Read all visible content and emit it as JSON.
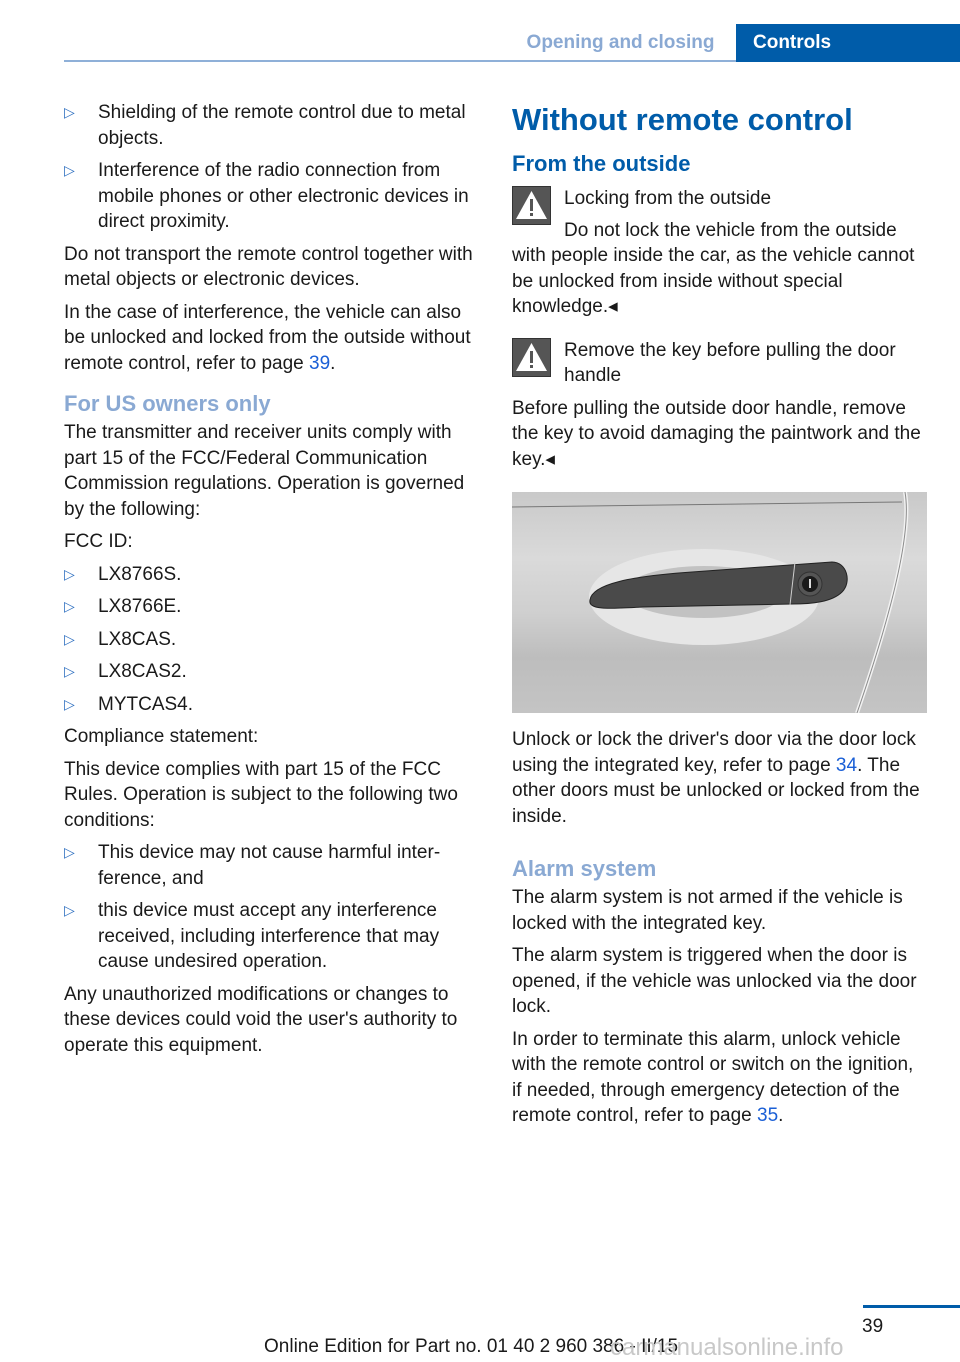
{
  "header": {
    "section": "Opening and closing",
    "chapter_tab": "Controls"
  },
  "left_column": {
    "bullets_top": [
      "Shielding of the remote control due to metal objects.",
      "Interference of the radio connection from mobile phones or other electronic devices in direct proximity."
    ],
    "para1": "Do not transport the remote control together with metal objects or electronic devices.",
    "para2_prefix": "In the case of interference, the vehicle can also be unlocked and locked from the outside with­out remote control, refer to page ",
    "para2_link": "39",
    "para2_suffix": ".",
    "us_heading": "For US owners only",
    "us_para": "The transmitter and receiver units comply with part 15 of the FCC/Federal Communication Commission regulations. Operation is gov­erned by the following:",
    "fcc_label": "FCC ID:",
    "fcc_ids": [
      "LX8766S.",
      "LX8766E.",
      "LX8CAS.",
      "LX8CAS2.",
      "MYTCAS4."
    ],
    "compliance_label": "Compliance statement:",
    "compliance_para": "This device complies with part 15 of the FCC Rules. Operation is subject to the following two conditions:",
    "conditions": [
      "This device may not cause harmful inter­ference, and",
      "this device must accept any interference received, including interference that may cause undesired operation."
    ],
    "final_para": "Any unauthorized modifications or changes to these devices could void the user's authority to operate this equipment."
  },
  "right_column": {
    "title": "Without remote control",
    "subtitle": "From the outside",
    "warning1": {
      "icon": "warning-triangle-icon",
      "title": "Locking from the outside",
      "body_first": "Do not lock the vehicle from the outside",
      "body_rest": "with people inside the car, as the vehicle can­not be unlocked from inside without special knowledge.◂"
    },
    "warning2": {
      "icon": "warning-triangle-icon",
      "title": "Remove the key before pulling the door handle",
      "body": "Before pulling the outside door handle, remove the key to avoid damaging the paintwork and the key.◂"
    },
    "image_alt": "Car door handle with integrated key lock",
    "unlock_prefix": "Unlock or lock the driver's door via the door lock using the integrated key, refer to page ",
    "unlock_link": "34",
    "unlock_suffix": ". The other doors must be unlocked or locked from the inside.",
    "alarm_heading": "Alarm system",
    "alarm_para1": "The alarm system is not armed if the vehicle is locked with the integrated key.",
    "alarm_para2": "The alarm system is triggered when the door is opened, if the vehicle was unlocked via the door lock.",
    "alarm_para3_prefix": "In order to terminate this alarm, unlock vehicle with the remote control or switch on the igni­tion, if needed, through emergency detection of the remote control, refer to page ",
    "alarm_para3_link": "35",
    "alarm_para3_suffix": "."
  },
  "footer": {
    "page_number": "39",
    "edition": "Online Edition for Part no. 01 40 2 960 386 - II/15",
    "watermark": "carmanualsonline.info"
  }
}
